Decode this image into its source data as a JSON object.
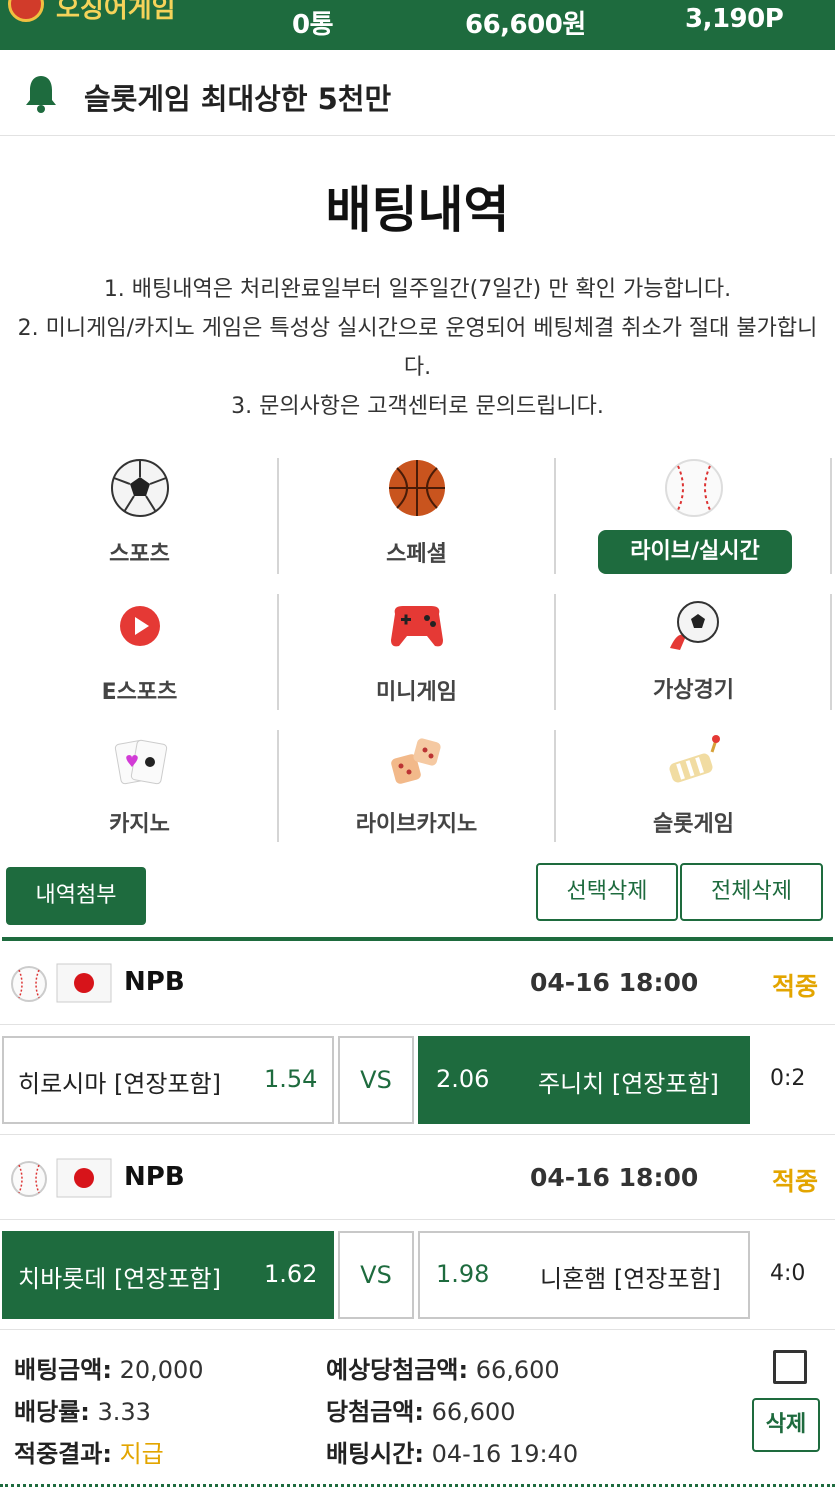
{
  "header": {
    "site_name": "오징어게임",
    "stat_messages": "0통",
    "stat_money": "66,600원",
    "stat_points": "3,190P"
  },
  "notice": {
    "icon": "bell-icon",
    "text": "슬롯게임 최대상한 5천만"
  },
  "page": {
    "title": "배팅내역",
    "rules": [
      "1. 배팅내역은 처리완료일부터 일주일간(7일간) 만 확인 가능합니다.",
      "2. 미니게임/카지노 게임은 특성상 실시간으로 운영되어 베팅체결 취소가 절대 불가합니다.",
      "3. 문의사항은 고객센터로 문의드립니다."
    ]
  },
  "categories": [
    {
      "label": "스포츠",
      "icon": "soccer-ball-icon",
      "active": false
    },
    {
      "label": "스페셜",
      "icon": "basketball-icon",
      "active": false
    },
    {
      "label": "라이브/실시간",
      "icon": "baseball-icon",
      "active": true
    },
    {
      "label": "E스포츠",
      "icon": "play-icon",
      "active": false
    },
    {
      "label": "미니게임",
      "icon": "gamepad-icon",
      "active": false
    },
    {
      "label": "가상경기",
      "icon": "soccer-ball-icon",
      "active": false
    },
    {
      "label": "카지노",
      "icon": "cards-icon",
      "active": false
    },
    {
      "label": "라이브카지노",
      "icon": "dice-icon",
      "active": false
    },
    {
      "label": "슬롯게임",
      "icon": "slot-icon",
      "active": false
    }
  ],
  "actions": {
    "attach": "내역첨부",
    "delete_selected": "선택삭제",
    "delete_all": "전체삭제"
  },
  "colors": {
    "primary": "#1e6b3e",
    "win": "#e3a500"
  },
  "matches": [
    {
      "league": "NPB",
      "time": "04-16 18:00",
      "status": "적중",
      "home": "히로시마 [연장포함]",
      "home_odds": "1.54",
      "vs": "VS",
      "away_odds": "2.06",
      "away": "주니치 [연장포함]",
      "score": "0:2",
      "selected": "away"
    },
    {
      "league": "NPB",
      "time": "04-16 18:00",
      "status": "적중",
      "home": "치바롯데 [연장포함]",
      "home_odds": "1.62",
      "vs": "VS",
      "away_odds": "1.98",
      "away": "니혼햄 [연장포함]",
      "score": "4:0",
      "selected": "home"
    }
  ],
  "summary": {
    "bet_amount_label": "배팅금액:",
    "bet_amount": "20,000",
    "odds_label": "배당률:",
    "odds": "3.33",
    "result_label": "적중결과:",
    "result": "지급",
    "expected_label": "예상당첨금액:",
    "expected": "66,600",
    "win_label": "당첨금액:",
    "win": "66,600",
    "time_label": "배팅시간:",
    "time": "04-16 19:40",
    "delete_label": "삭제"
  }
}
